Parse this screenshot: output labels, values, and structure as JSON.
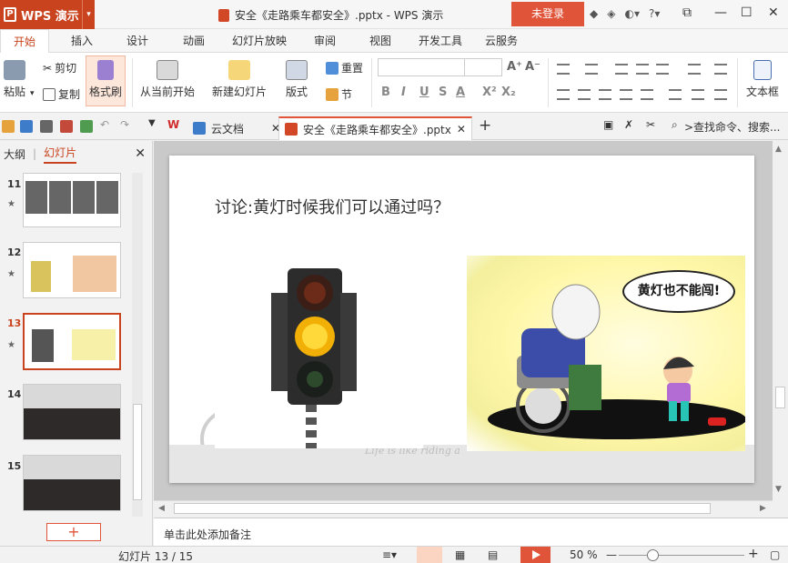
{
  "titlebar": {
    "app_name": "WPS 演示",
    "window_title": "安全《走路乘车都安全》.pptx - WPS 演示",
    "login_label": "未登录"
  },
  "menu": {
    "tabs": [
      "开始",
      "插入",
      "设计",
      "动画",
      "幻灯片放映",
      "审阅",
      "视图",
      "开发工具",
      "云服务"
    ],
    "active_tab": "开始"
  },
  "ribbon": {
    "paste": "粘贴",
    "cut": "剪切",
    "copy": "复制",
    "format_painter": "格式刷",
    "from_current": "从当前开始",
    "new_slide": "新建幻灯片",
    "layout": "版式",
    "reset": "重置",
    "section": "节",
    "textbox": "文本框"
  },
  "doc_tabs": {
    "cloud_docs": "云文档",
    "document": "安全《走路乘车都安全》.pptx",
    "search_placeholder": ">查找命令、搜索..."
  },
  "left_panel": {
    "outline_tab": "大纲",
    "slides_tab": "幻灯片",
    "thumbnails": [
      {
        "num": "11",
        "star": "★"
      },
      {
        "num": "12",
        "star": "★"
      },
      {
        "num": "13",
        "star": "★"
      },
      {
        "num": "14",
        "star": ""
      },
      {
        "num": "15",
        "star": ""
      }
    ],
    "add_label": "+"
  },
  "slide": {
    "title": "讨论:黄灯时候我们可以通过吗？",
    "speech_bubble": "黄灯也不能闯!",
    "watermark": "Life is like riding a"
  },
  "notes": {
    "placeholder": "单击此处添加备注"
  },
  "status": {
    "slide_counter": "幻灯片 13 / 15",
    "zoom": "50 %",
    "zoom_level": 0.27
  }
}
